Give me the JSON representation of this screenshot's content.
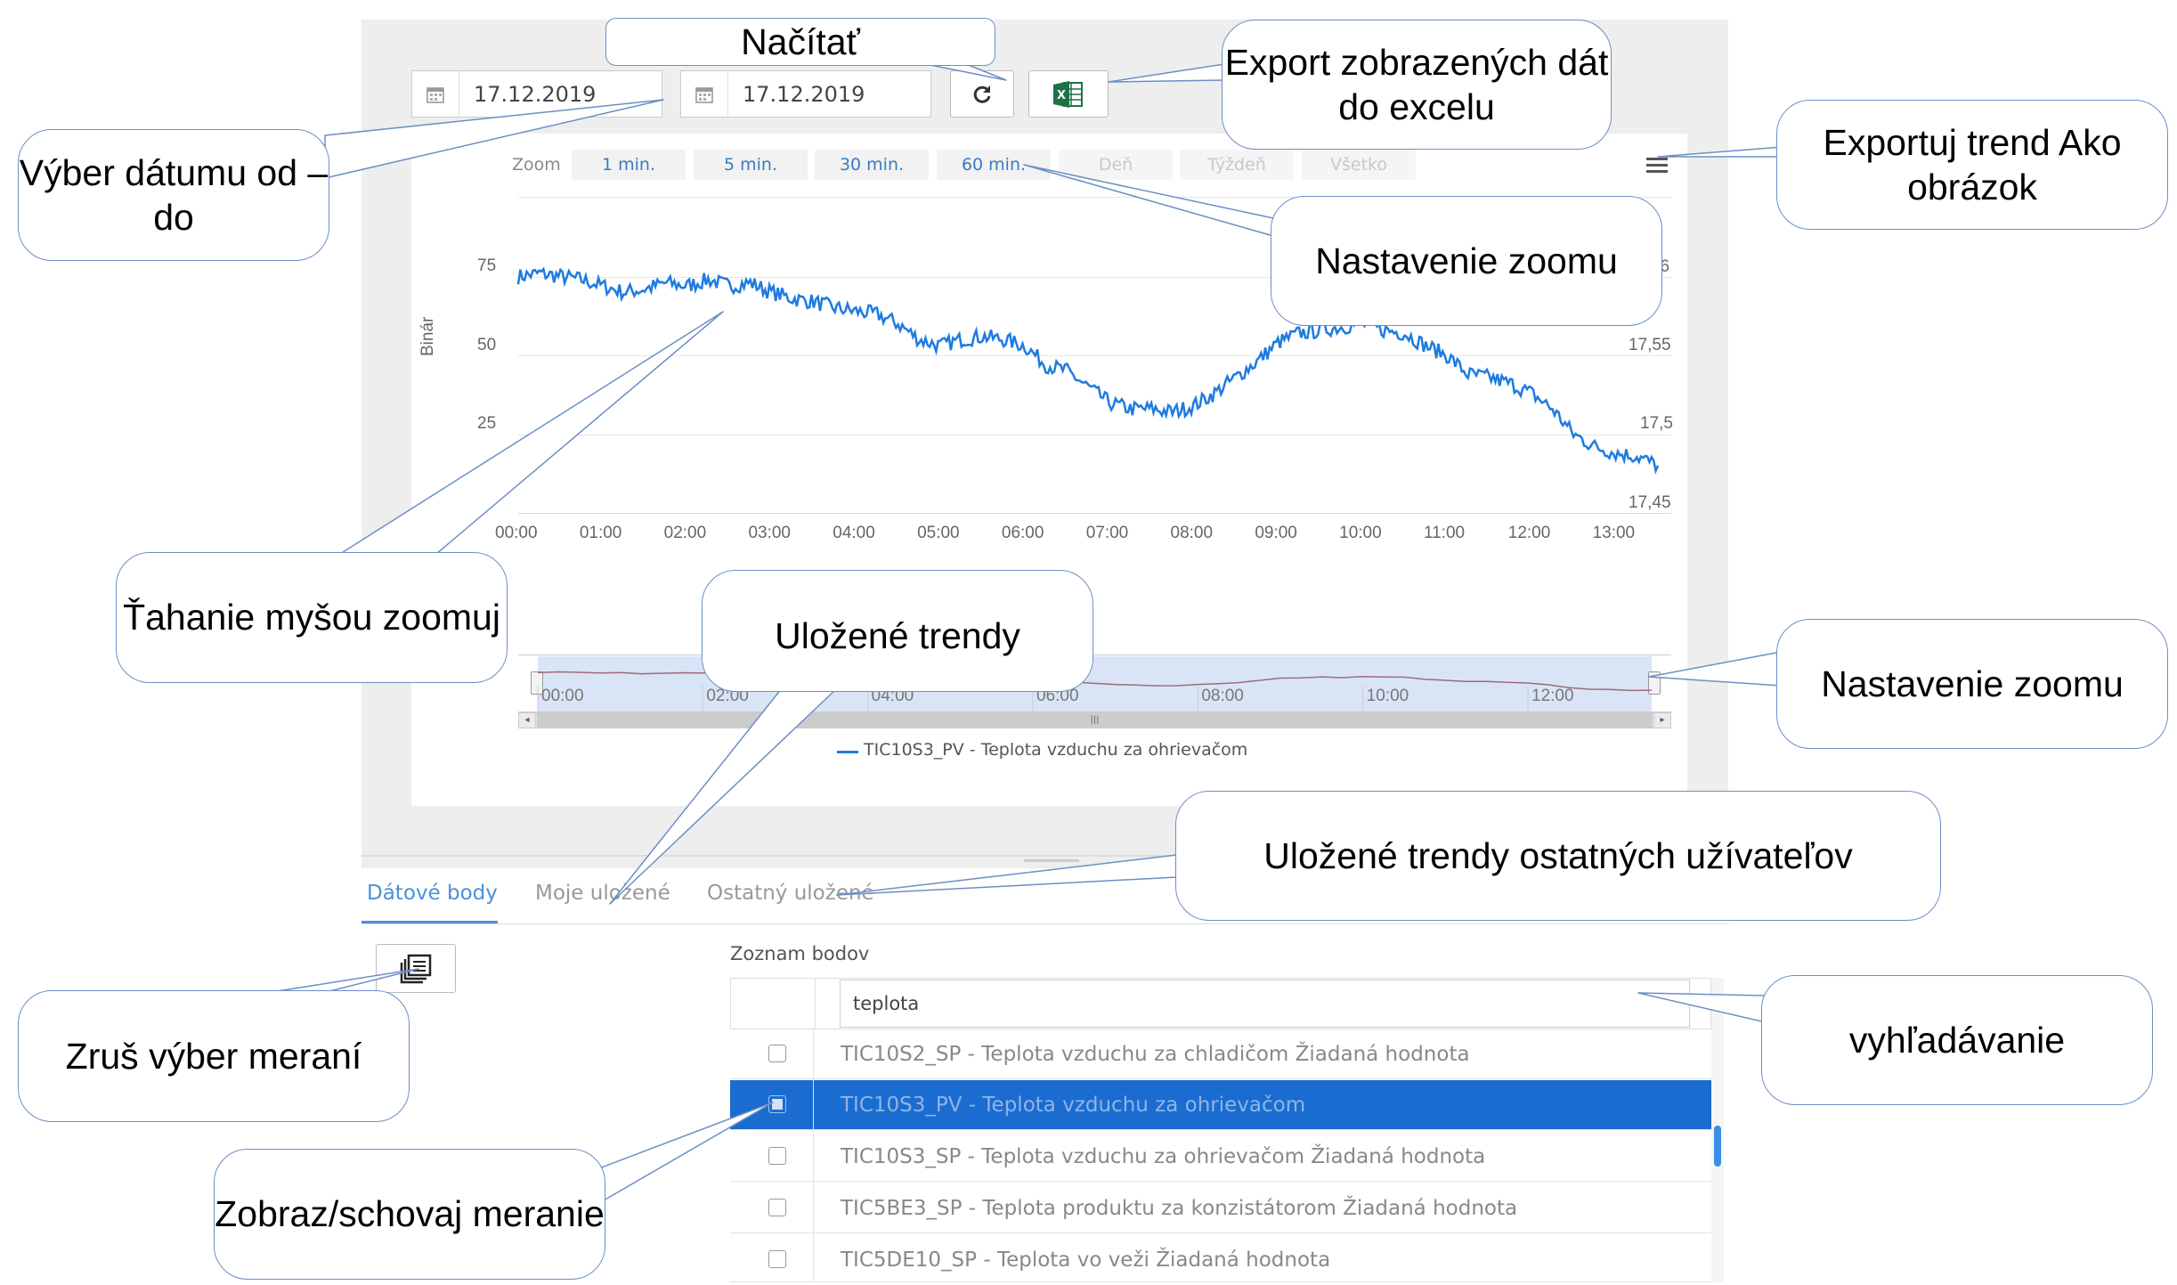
{
  "dates": {
    "from": "17.12.2019",
    "to": "17.12.2019"
  },
  "zoom": {
    "label": "Zoom",
    "buttons": [
      {
        "label": "1 min.",
        "enabled": true
      },
      {
        "label": "5 min.",
        "enabled": true
      },
      {
        "label": "30 min.",
        "enabled": true
      },
      {
        "label": "60 min.",
        "enabled": true
      },
      {
        "label": "Deň",
        "enabled": false
      },
      {
        "label": "Týždeň",
        "enabled": false
      },
      {
        "label": "Všetko",
        "enabled": false
      }
    ]
  },
  "chart_data": {
    "type": "line",
    "ylabel": "Binár",
    "ylim": [
      0,
      100
    ],
    "y_ticks": [
      "75",
      "50",
      "25"
    ],
    "y2_ticks": [
      "17,6",
      "17,55",
      "17,5",
      "17,45"
    ],
    "x_ticks": [
      "00:00",
      "01:00",
      "02:00",
      "03:00",
      "04:00",
      "05:00",
      "06:00",
      "07:00",
      "08:00",
      "09:00",
      "10:00",
      "11:00",
      "12:00",
      "13:00"
    ],
    "series": [
      {
        "name": "TIC10S3_PV - Teplota vzduchu za ohrievačom",
        "color": "#1e7be0",
        "x": [
          0,
          0.25,
          0.5,
          0.75,
          1,
          1.25,
          1.5,
          1.75,
          2,
          2.25,
          2.5,
          2.75,
          3,
          3.25,
          3.5,
          3.75,
          4,
          4.25,
          4.5,
          4.75,
          5,
          5.25,
          5.5,
          5.75,
          6,
          6.25,
          6.5,
          6.75,
          7,
          7.25,
          7.5,
          7.75,
          8,
          8.25,
          8.5,
          8.75,
          9,
          9.25,
          9.5,
          9.75,
          10,
          10.25,
          10.5,
          10.75,
          11,
          11.25,
          11.5,
          11.75,
          12,
          12.25,
          12.5,
          12.75,
          13,
          13.25,
          13.5
        ],
        "values": [
          75,
          76,
          75,
          74,
          72,
          70,
          71,
          73,
          72,
          74,
          72,
          73,
          70,
          68,
          67,
          65,
          64,
          63,
          60,
          55,
          53,
          55,
          56,
          55,
          53,
          47,
          45,
          40,
          35,
          33,
          33,
          32,
          34,
          38,
          43,
          48,
          54,
          57,
          58,
          59,
          60,
          58,
          57,
          53,
          50,
          44,
          43,
          41,
          38,
          33,
          25,
          21,
          19,
          18,
          15
        ]
      }
    ],
    "navigator_x_ticks": [
      "00:00",
      "02:00",
      "04:00",
      "06:00",
      "08:00",
      "10:00",
      "12:00"
    ]
  },
  "tabs": [
    "Dátové body",
    "Moje uložené",
    "Ostatný uložené"
  ],
  "points": {
    "title": "Zoznam bodov",
    "search_value": "teplota",
    "rows": [
      {
        "label": "TIC10S2_SP - Teplota vzduchu za chladičom Žiadaná hodnota",
        "selected": false
      },
      {
        "label": "TIC10S3_PV - Teplota vzduchu za ohrievačom",
        "selected": true
      },
      {
        "label": "TIC10S3_SP - Teplota vzduchu za ohrievačom Žiadaná hodnota",
        "selected": false
      },
      {
        "label": "TIC5BE3_SP - Teplota produktu za konzistátorom Žiadaná hodnota",
        "selected": false
      },
      {
        "label": "TIC5DE10_SP - Teplota vo veži Žiadaná hodnota",
        "selected": false
      }
    ]
  },
  "callouts": {
    "nacitat": "Načítať",
    "export_excel": "Export zobrazených dát do excelu",
    "vyber_datumu": "Výber dátumu od – do",
    "export_trend": "Exportuj trend Ako obrázok",
    "zoom1": "Nastavenie zoomu",
    "tahanie": "Ťahanie myšou zoomuj",
    "ulozene": "Uložené trendy",
    "zoom2": "Nastavenie zoomu",
    "ostatnych": "Uložené trendy ostatných užívateľov",
    "zrus": "Zruš výber meraní",
    "vyhladavanie": "vyhľadávanie",
    "zobraz": "Zobraz/schovaj meranie"
  }
}
